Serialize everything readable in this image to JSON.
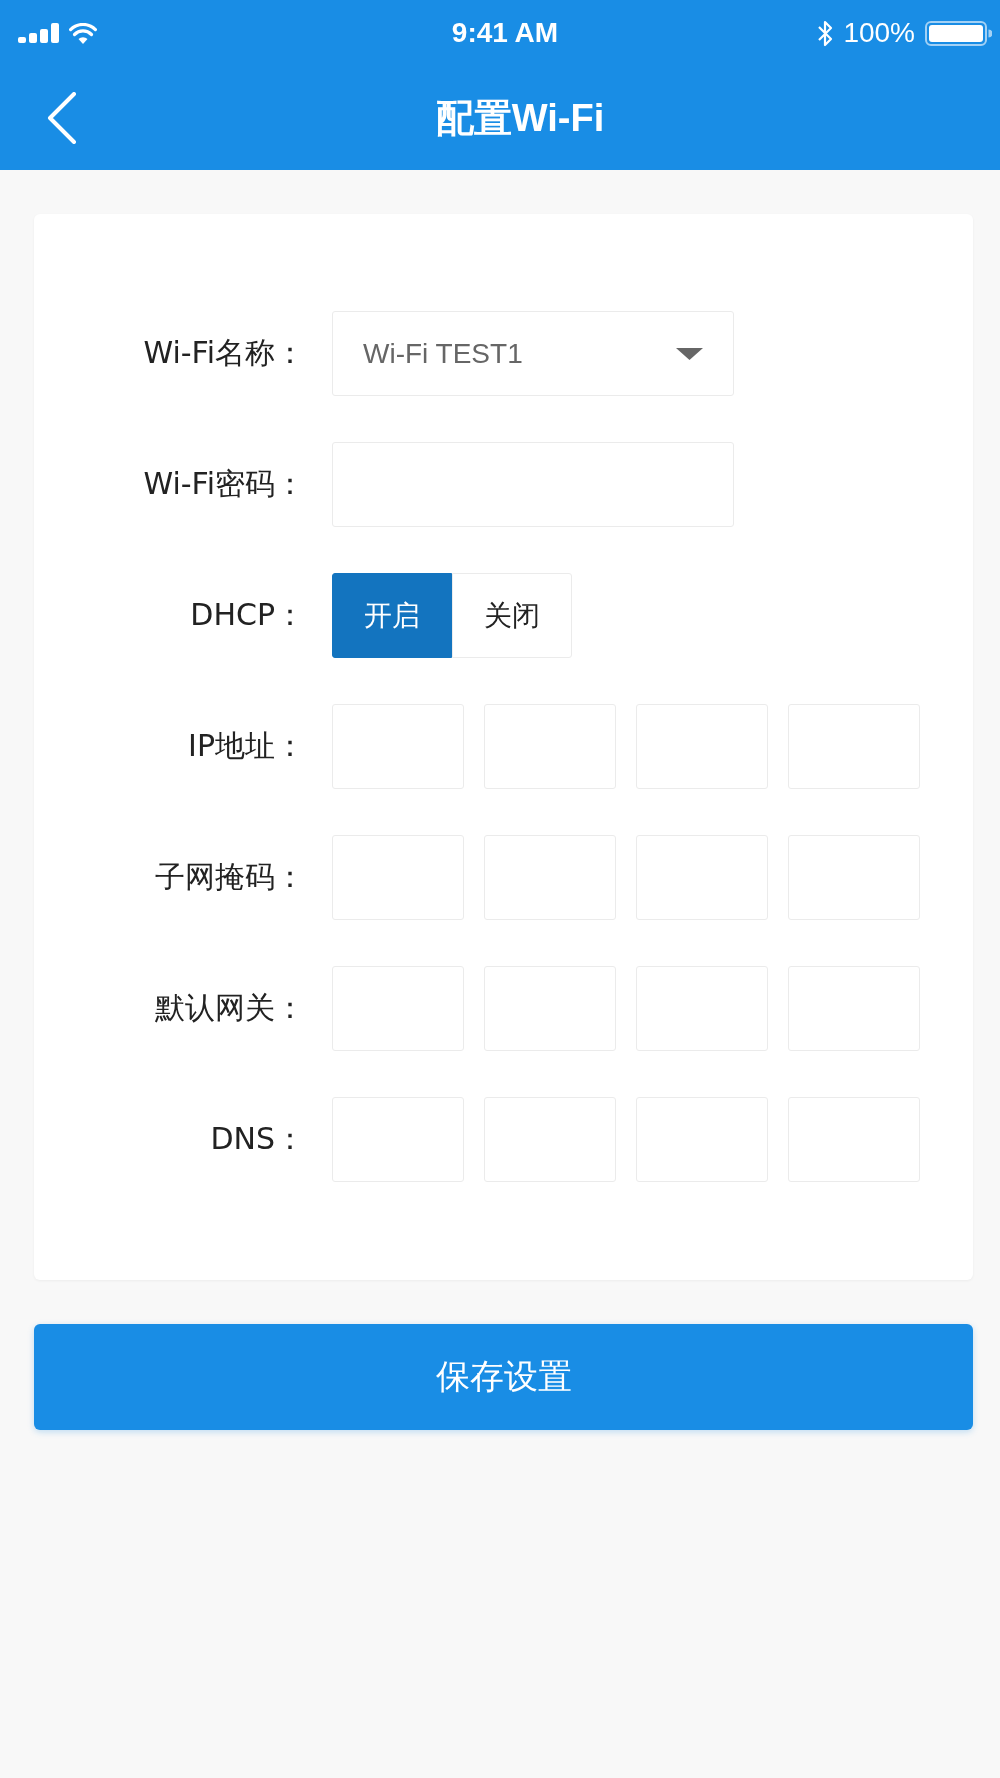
{
  "status_bar": {
    "time": "9:41 AM",
    "battery": "100%"
  },
  "header": {
    "title": "配置Wi-Fi"
  },
  "form": {
    "rows": [
      {
        "kind": "select",
        "label": "Wi-Fi名称：",
        "value": "Wi-Fi TEST1"
      },
      {
        "kind": "password",
        "label": "Wi-Fi密码："
      },
      {
        "kind": "toggle",
        "label": "DHCP：",
        "options": [
          {
            "label": "开启",
            "selected": true
          },
          {
            "label": "关闭",
            "selected": false
          }
        ]
      },
      {
        "kind": "ip",
        "label": "IP地址："
      },
      {
        "kind": "ip",
        "label": "子网掩码："
      },
      {
        "kind": "ip",
        "label": "默认网关："
      },
      {
        "kind": "ip",
        "label": "DNS："
      }
    ]
  },
  "save_button": {
    "label": "保存设置"
  }
}
